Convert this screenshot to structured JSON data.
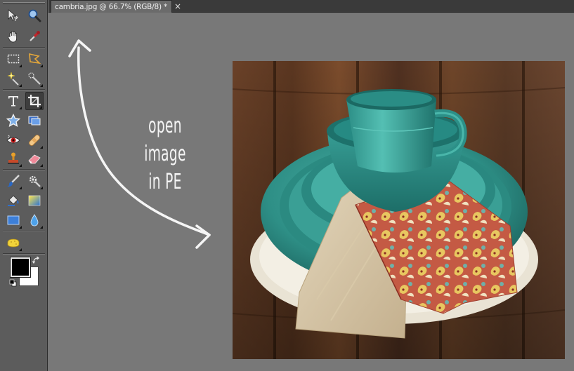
{
  "document": {
    "tab_title": "cambria.jpg @ 66.7% (RGB/8) *",
    "close_glyph": "×"
  },
  "toolbox": {
    "tools": [
      {
        "name": "move-tool",
        "icon": "move-icon"
      },
      {
        "name": "zoom-tool",
        "icon": "zoom-icon"
      },
      {
        "name": "hand-tool",
        "icon": "hand-icon"
      },
      {
        "name": "eyedropper-tool",
        "icon": "eyedropper-icon"
      },
      {
        "name": "rectangular-marquee-tool",
        "icon": "marquee-icon"
      },
      {
        "name": "lasso-tool",
        "icon": "lasso-icon"
      },
      {
        "name": "magic-wand-tool",
        "icon": "magic-wand-icon"
      },
      {
        "name": "quick-selection-tool",
        "icon": "quick-selection-icon"
      },
      {
        "name": "type-tool",
        "icon": "type-icon",
        "glyph": "T"
      },
      {
        "name": "crop-tool",
        "icon": "crop-icon",
        "active": true
      },
      {
        "name": "cookie-cutter-tool",
        "icon": "cookie-cutter-icon"
      },
      {
        "name": "straighten-tool",
        "icon": "straighten-icon"
      },
      {
        "name": "red-eye-tool",
        "icon": "red-eye-icon"
      },
      {
        "name": "healing-brush-tool",
        "icon": "healing-brush-icon"
      },
      {
        "name": "clone-stamp-tool",
        "icon": "clone-stamp-icon"
      },
      {
        "name": "eraser-tool",
        "icon": "eraser-icon"
      },
      {
        "name": "brush-tool",
        "icon": "brush-icon"
      },
      {
        "name": "smart-brush-tool",
        "icon": "smart-brush-icon"
      },
      {
        "name": "paint-bucket-tool",
        "icon": "paint-bucket-icon"
      },
      {
        "name": "gradient-tool",
        "icon": "gradient-icon"
      },
      {
        "name": "shape-tool",
        "icon": "shape-icon"
      },
      {
        "name": "blur-tool",
        "icon": "blur-icon"
      },
      {
        "name": "sponge-tool",
        "icon": "sponge-icon"
      }
    ],
    "foreground_color": "#000000",
    "background_color": "#ffffff"
  },
  "annotation": {
    "line1": "open image",
    "line2": "in PE"
  },
  "colors": {
    "workspace": "#787878",
    "toolbox": "#5c5c5c",
    "annotation": "#f4f4f4",
    "turquoise": "#2f8f86"
  }
}
